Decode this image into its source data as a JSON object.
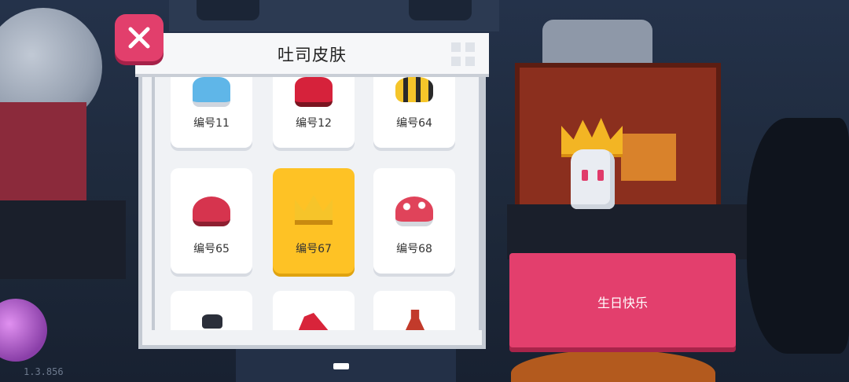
{
  "panel": {
    "title": "吐司皮肤"
  },
  "skins": [
    {
      "label": "编号11",
      "icon": "blue-hat-icon",
      "selected": false
    },
    {
      "label": "编号12",
      "icon": "red-hat-icon",
      "selected": false
    },
    {
      "label": "编号64",
      "icon": "bee-hat-icon",
      "selected": false
    },
    {
      "label": "编号65",
      "icon": "cherry-hat-icon",
      "selected": false
    },
    {
      "label": "编号67",
      "icon": "crown-hat-icon",
      "selected": true
    },
    {
      "label": "编号68",
      "icon": "mushroom-hat-icon",
      "selected": false
    },
    {
      "label": "",
      "icon": "dark-hat-icon",
      "selected": false
    },
    {
      "label": "",
      "icon": "santa-hat-icon",
      "selected": false
    },
    {
      "label": "",
      "icon": "bottle-hat-icon",
      "selected": false
    }
  ],
  "action_button": {
    "label": "生日快乐"
  },
  "version": "1.3.856",
  "colors": {
    "accent_pink": "#e23f6c",
    "selected_yellow": "#fec225"
  }
}
